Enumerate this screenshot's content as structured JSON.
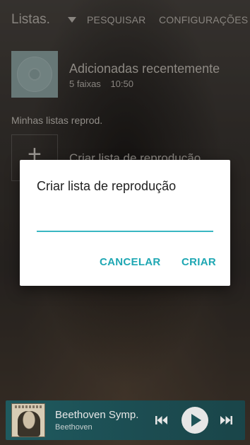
{
  "app_bar": {
    "title": "Listas.",
    "search_label": "PESQUISAR",
    "settings_label": "CONFIGURAÇÕES"
  },
  "recent": {
    "name": "Adicionadas recentemente",
    "tracks": "5 faixas",
    "duration": "10:50"
  },
  "section": {
    "label": "Minhas listas reprod."
  },
  "create_row": {
    "plus": "+",
    "label": "Criar lista de reprodução"
  },
  "dialog": {
    "title": "Criar lista de reprodução",
    "input_value": "",
    "cancel_label": "CANCELAR",
    "create_label": "CRIAR",
    "accent_color": "#1ea7b3"
  },
  "mini_player": {
    "track": "Beethoven Symp.",
    "artist": "Beethoven",
    "icons": [
      "previous-icon",
      "play-icon",
      "next-icon"
    ]
  }
}
